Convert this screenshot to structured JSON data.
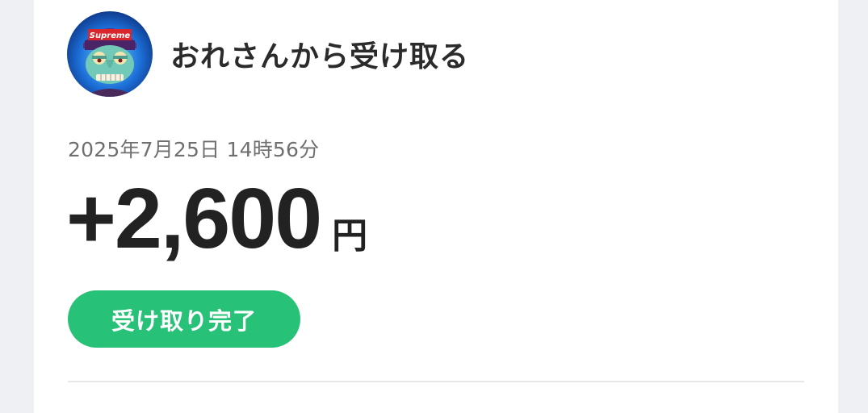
{
  "header": {
    "sender_text": "おれさんから受け取る",
    "avatar_label": "Supreme"
  },
  "transaction": {
    "datetime": "2025年7月25日 14時56分",
    "amount": "+2,600",
    "currency": "円",
    "status": "受け取り完了"
  },
  "colors": {
    "status_green": "#27c277",
    "text_dark": "#222222",
    "text_gray": "#6f6f6f"
  }
}
